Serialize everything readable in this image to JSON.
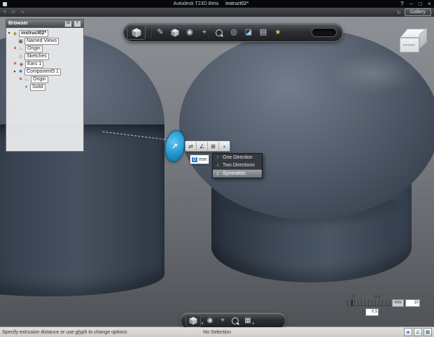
{
  "titlebar": {
    "app_title": "Autodesk T23D Beta",
    "document": "instruct02*",
    "help": "?",
    "minimize": "–",
    "maximize": "□",
    "close": "×"
  },
  "appbar": {
    "gallery_label": "Gallery"
  },
  "browser": {
    "title": "Browser",
    "items": [
      {
        "label": "instruct02*"
      },
      {
        "label": "Named Views"
      },
      {
        "label": "Origin"
      },
      {
        "label": "Sketches"
      },
      {
        "label": "Ears 1"
      },
      {
        "label": "Component5 1"
      },
      {
        "label": "Origin"
      },
      {
        "label": "Solid"
      }
    ]
  },
  "viewcube": {
    "front": "FRONT"
  },
  "extrude": {
    "value": "0",
    "unit": "mm",
    "options": [
      {
        "label": "One Direction"
      },
      {
        "label": "Two Directions"
      },
      {
        "label": "Symmetric"
      }
    ]
  },
  "scale_ruler": {
    "start": "0",
    "end": "6.4",
    "unit": "mm",
    "major": "10",
    "step": "0.5"
  },
  "statusbar": {
    "hint": "Specify extrusion distance or use glyph to change options",
    "selection": "No Selection"
  },
  "icons": {
    "app_menu": "≡",
    "undo": "↶",
    "redo": "↷",
    "sync": "↻",
    "pencil": "✎",
    "orbit": "◉",
    "pan": "+",
    "look": "◎",
    "section": "◪",
    "pattern": "▤",
    "star": "★",
    "camera": "▣",
    "origin": "∟",
    "sketch": "◇",
    "feature": "◆",
    "component": "■",
    "solid": "●",
    "assembly": "◆",
    "hidden": "×",
    "twisty": "▾",
    "caret": "▾",
    "options": "⊞",
    "close": "×",
    "flip": "⇄",
    "angle": "∠",
    "operation": "⊞",
    "extent": "◗",
    "dir_one": "↑",
    "dir_two": "↕",
    "dir_sym": "⇕",
    "arrow": "↗",
    "left": "‹",
    "right": "›",
    "grid": "▦",
    "snap": "∠",
    "filter": "◈"
  }
}
